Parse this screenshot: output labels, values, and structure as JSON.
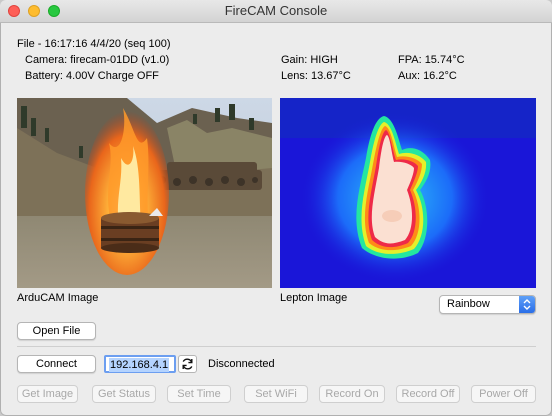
{
  "window": {
    "title": "FireCAM Console"
  },
  "info": {
    "file_line": "File - 16:17:16 4/4/20  (seq 100)",
    "camera": "Camera: firecam-01DD  (v1.0)",
    "battery": "Battery: 4.00V  Charge OFF",
    "gain": "Gain: HIGH",
    "lens": "Lens: 13.67°C",
    "fpa": "FPA: 15.74°C",
    "aux": "Aux: 16.2°C"
  },
  "images": {
    "arducam_label": "ArduCAM Image",
    "lepton_label": "Lepton Image",
    "palette_selected": "Rainbow"
  },
  "buttons": {
    "open_file": "Open File",
    "connect": "Connect",
    "get_image": "Get Image",
    "get_status": "Get Status",
    "set_time": "Set Time",
    "set_wifi": "Set WiFi",
    "record_on": "Record On",
    "record_off": "Record Off",
    "power_off": "Power Off"
  },
  "connection": {
    "ip_address": "192.168.4.1",
    "status": "Disconnected"
  },
  "icons": {
    "refresh": "refresh-icon",
    "select_arrow": "chevron-updown-icon"
  },
  "colors": {
    "accent": "#2a6ee8",
    "selection": "#b4d3fe",
    "thermal_cold": "#1a16d8",
    "thermal_hot": "#f2d8c8"
  }
}
